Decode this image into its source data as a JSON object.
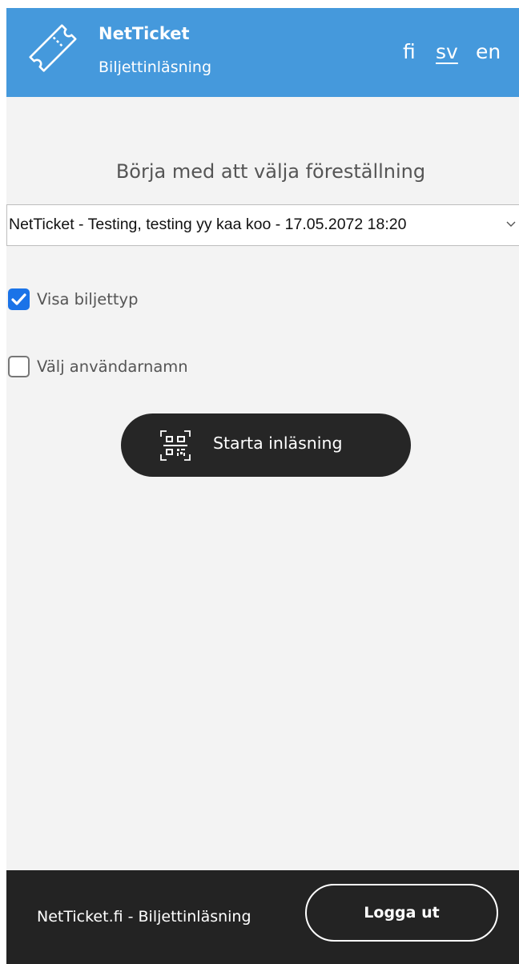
{
  "header": {
    "brand_name": "NetTicket",
    "brand_subtitle": "Biljettinläsning",
    "languages": [
      {
        "code": "fi",
        "label": "fi",
        "active": false
      },
      {
        "code": "sv",
        "label": "sv",
        "active": true
      },
      {
        "code": "en",
        "label": "en",
        "active": false
      }
    ],
    "background_color": "#4599dc",
    "logo_icon": "ticket-icon"
  },
  "main": {
    "prompt": "Börja med att välja föreställning",
    "event_select": {
      "selected": "NetTicket - Testing, testing yy kaa koo - 17.05.2072 18:20",
      "icon": "chevron-down-icon"
    },
    "options": [
      {
        "label": "Visa biljettyp",
        "checked": true
      },
      {
        "label": "Välj användarnamn",
        "checked": false
      }
    ],
    "start_button": {
      "label": "Starta inläsning",
      "icon": "qr-code-icon"
    },
    "accent_color": "#1a73e8"
  },
  "footer": {
    "text": "NetTicket.fi - Biljettinläsning",
    "logout_label": "Logga ut",
    "background_color": "#232323"
  }
}
